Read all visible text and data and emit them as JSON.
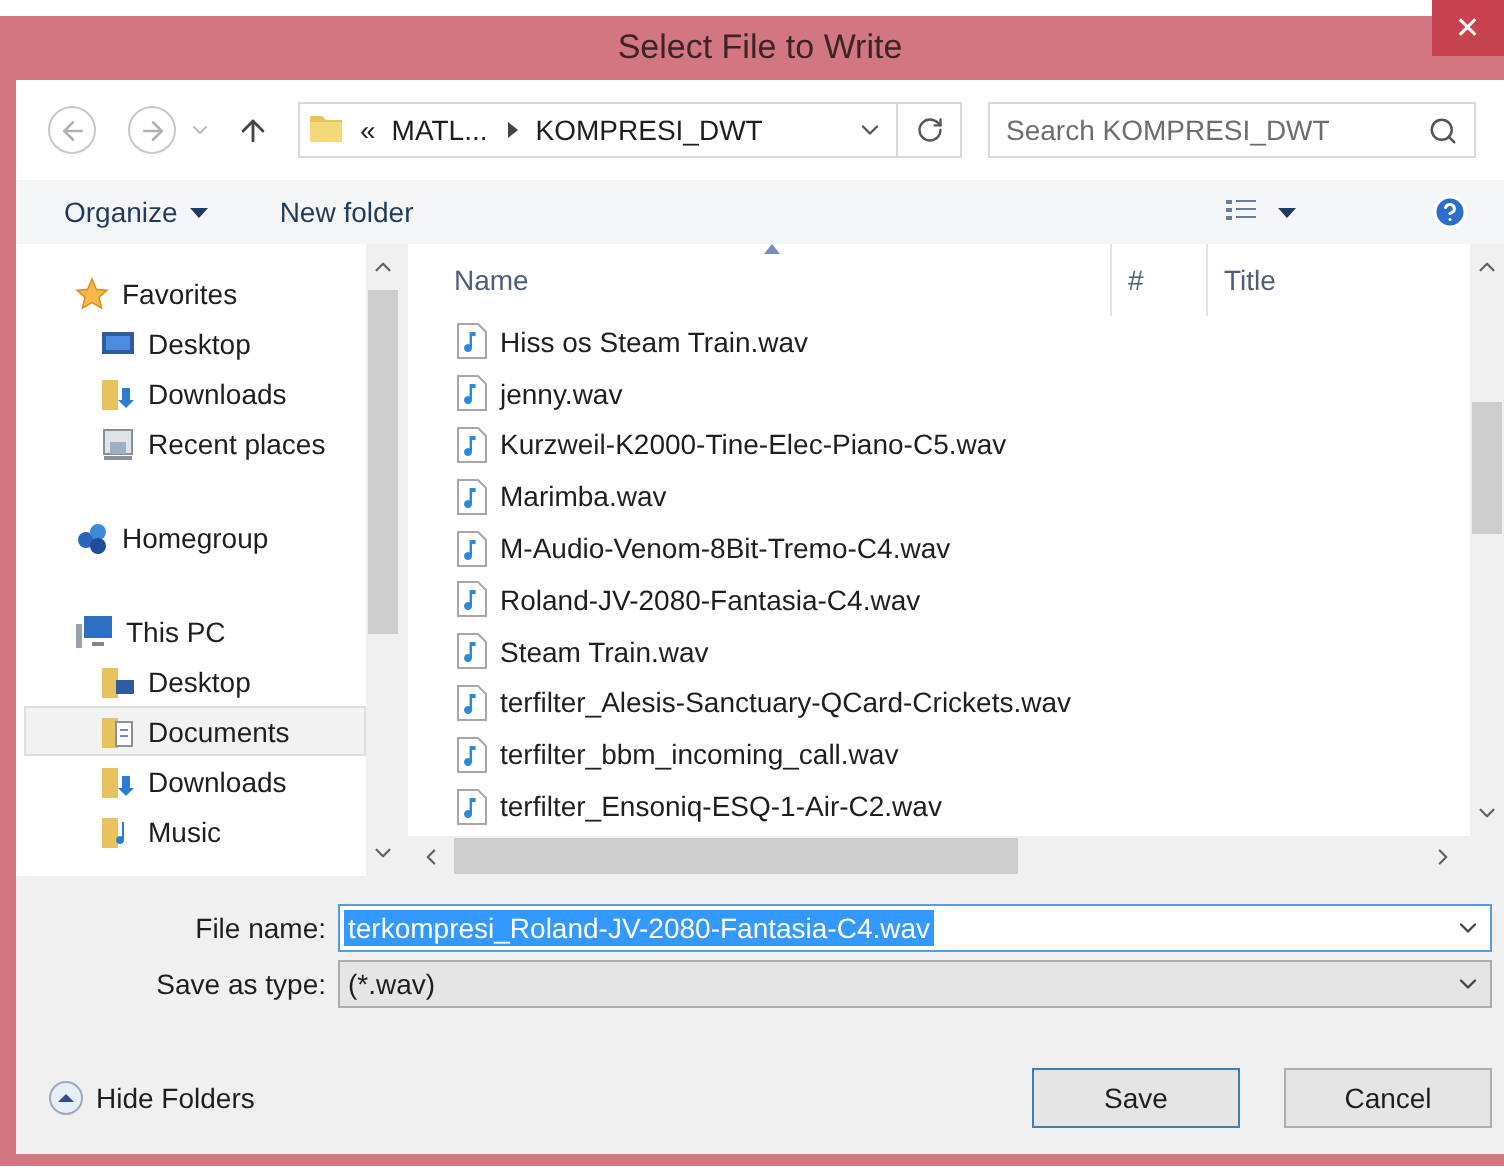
{
  "window": {
    "title": "Select File to Write",
    "close": "✕"
  },
  "address": {
    "overflow": "«",
    "segments": [
      "MATL...",
      "KOMPRESI_DWT"
    ]
  },
  "search": {
    "placeholder": "Search KOMPRESI_DWT"
  },
  "toolbar": {
    "buttons": [
      "Organize",
      "New folder"
    ]
  },
  "sidebar": {
    "items": [
      {
        "label": "Favorites",
        "selected": false,
        "children": [
          {
            "label": "Desktop",
            "selected": false
          },
          {
            "label": "Downloads",
            "selected": false
          },
          {
            "label": "Recent places",
            "selected": false
          }
        ]
      },
      {
        "label": "Homegroup",
        "selected": false
      },
      {
        "label": "This PC",
        "selected": false,
        "children": [
          {
            "label": "Desktop",
            "selected": false
          },
          {
            "label": "Documents",
            "selected": true
          },
          {
            "label": "Downloads",
            "selected": false
          },
          {
            "label": "Music",
            "selected": false
          }
        ]
      }
    ]
  },
  "table": {
    "columns": [
      "Name",
      "#",
      "Title"
    ],
    "rows": [
      "Hiss os Steam Train.wav",
      "jenny.wav",
      "Kurzweil-K2000-Tine-Elec-Piano-C5.wav",
      "Marimba.wav",
      "M-Audio-Venom-8Bit-Tremo-C4.wav",
      "Roland-JV-2080-Fantasia-C4.wav",
      "Steam Train.wav",
      "terfilter_Alesis-Sanctuary-QCard-Crickets.wav",
      "terfilter_bbm_incoming_call.wav",
      "terfilter_Ensoniq-ESQ-1-Air-C2.wav"
    ]
  },
  "form": {
    "file_name": {
      "label": "File name:",
      "value": "terkompresi_Roland-JV-2080-Fantasia-C4.wav",
      "text_selected": true
    },
    "save_as_type": {
      "label": "Save as type:",
      "value": "(*.wav)"
    }
  },
  "hide_folders": "Hide Folders",
  "buttons": [
    {
      "label": "Save",
      "default": true
    },
    {
      "label": "Cancel",
      "default": false
    }
  ]
}
